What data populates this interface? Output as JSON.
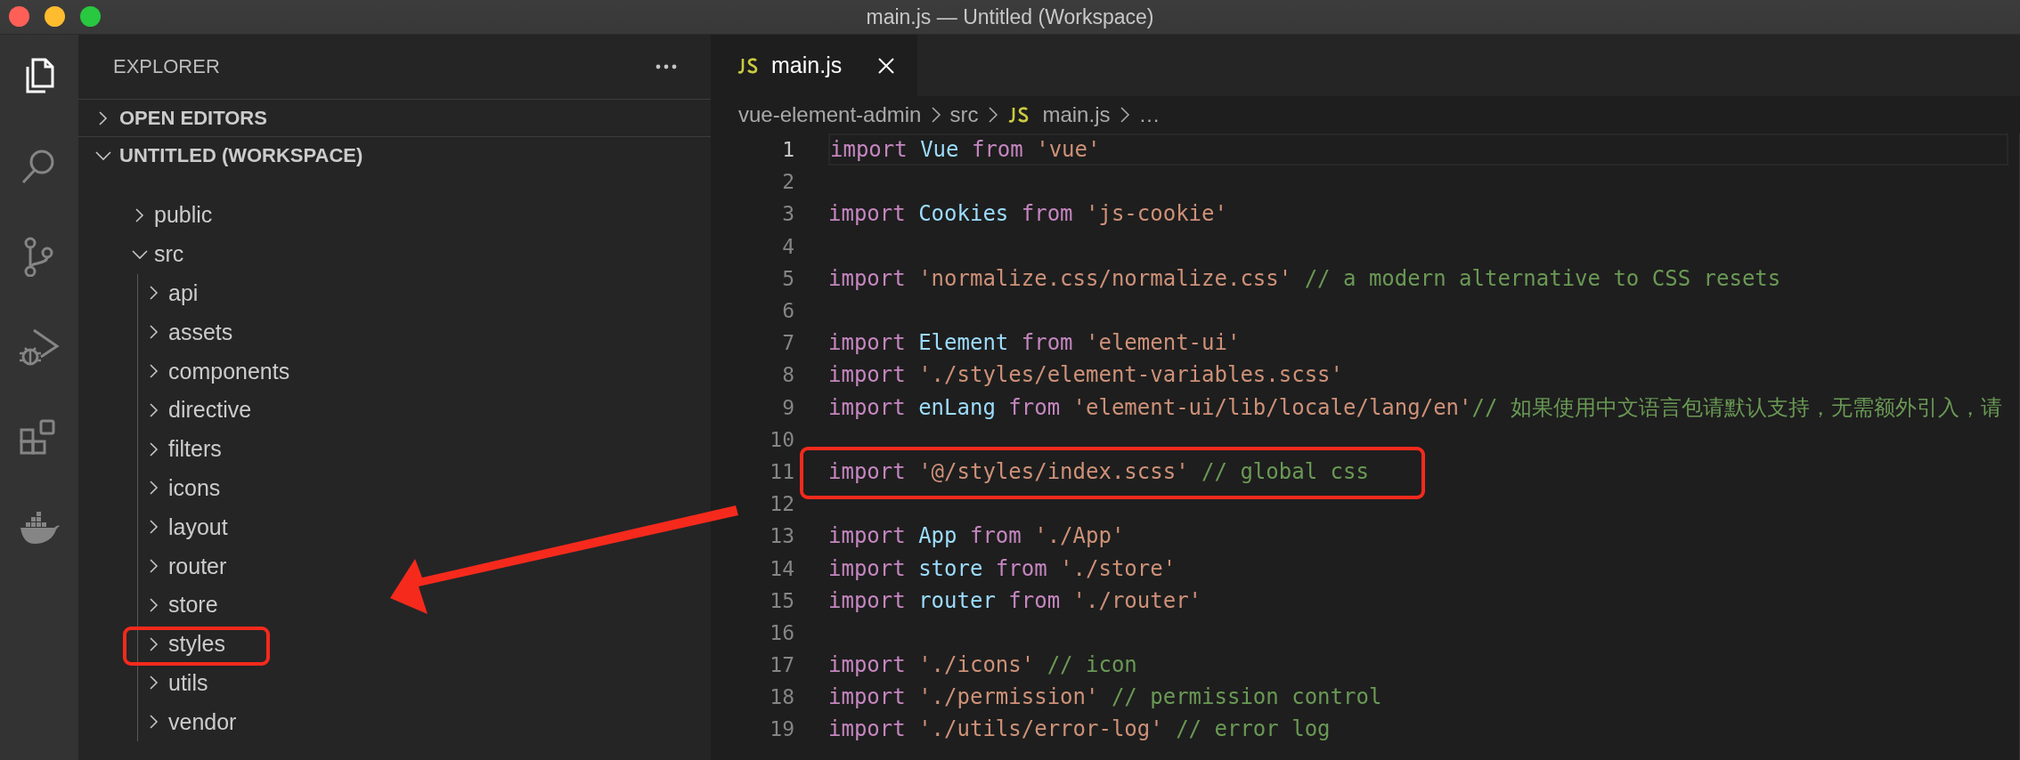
{
  "window": {
    "title": "main.js — Untitled (Workspace)"
  },
  "activity_bar": [
    {
      "kind": "explorer",
      "selected": true
    },
    {
      "kind": "search",
      "selected": false
    },
    {
      "kind": "source-control",
      "selected": false
    },
    {
      "kind": "run-debug",
      "selected": false
    },
    {
      "kind": "extensions",
      "selected": false
    },
    {
      "kind": "docker",
      "selected": false
    }
  ],
  "sidebar": {
    "title": "EXPLORER",
    "sections": [
      {
        "label": "OPEN EDITORS",
        "expanded": false
      },
      {
        "label": "UNTITLED (WORKSPACE)",
        "expanded": true,
        "children": [
          {
            "label": "public",
            "expanded": false
          },
          {
            "label": "src",
            "expanded": true,
            "children": [
              {
                "label": "api",
                "expanded": false
              },
              {
                "label": "assets",
                "expanded": false
              },
              {
                "label": "components",
                "expanded": false
              },
              {
                "label": "directive",
                "expanded": false
              },
              {
                "label": "filters",
                "expanded": false
              },
              {
                "label": "icons",
                "expanded": false
              },
              {
                "label": "layout",
                "expanded": false
              },
              {
                "label": "router",
                "expanded": false
              },
              {
                "label": "store",
                "expanded": false
              },
              {
                "label": "styles",
                "expanded": false
              },
              {
                "label": "utils",
                "expanded": false
              },
              {
                "label": "vendor",
                "expanded": false
              }
            ]
          }
        ]
      }
    ]
  },
  "tabs": [
    {
      "label": "main.js",
      "selected": true
    }
  ],
  "breadcrumbs": [
    {
      "kind": "folder",
      "label": "vue-element-admin"
    },
    {
      "kind": "folder",
      "label": "src"
    },
    {
      "kind": "file",
      "label": "main.js"
    },
    {
      "kind": "more",
      "label": "…"
    }
  ],
  "editor": {
    "lines": [
      {
        "number": "1",
        "current": true,
        "tokens": [
          {
            "kind": "keyword",
            "text": "import "
          },
          {
            "kind": "ident",
            "text": "Vue "
          },
          {
            "kind": "keyword",
            "text": "from "
          },
          {
            "kind": "string",
            "text": "'vue'"
          }
        ]
      },
      {
        "number": "2",
        "current": false
      },
      {
        "number": "3",
        "current": false,
        "tokens": [
          {
            "kind": "keyword",
            "text": "import "
          },
          {
            "kind": "ident",
            "text": "Cookies "
          },
          {
            "kind": "keyword",
            "text": "from "
          },
          {
            "kind": "string",
            "text": "'js-cookie'"
          }
        ]
      },
      {
        "number": "4",
        "current": false
      },
      {
        "number": "5",
        "current": false,
        "tokens": [
          {
            "kind": "keyword",
            "text": "import "
          },
          {
            "kind": "string",
            "text": "'normalize.css/normalize.css' "
          },
          {
            "kind": "comment",
            "text": "// a modern alternative to CSS resets"
          }
        ]
      },
      {
        "number": "6",
        "current": false
      },
      {
        "number": "7",
        "current": false,
        "tokens": [
          {
            "kind": "keyword",
            "text": "import "
          },
          {
            "kind": "ident",
            "text": "Element "
          },
          {
            "kind": "keyword",
            "text": "from "
          },
          {
            "kind": "string",
            "text": "'element-ui'"
          }
        ]
      },
      {
        "number": "8",
        "current": false,
        "tokens": [
          {
            "kind": "keyword",
            "text": "import "
          },
          {
            "kind": "string",
            "text": "'./styles/element-variables.scss'"
          }
        ]
      },
      {
        "number": "9",
        "current": false,
        "tokens": [
          {
            "kind": "keyword",
            "text": "import "
          },
          {
            "kind": "ident",
            "text": "enLang "
          },
          {
            "kind": "keyword",
            "text": "from "
          },
          {
            "kind": "string",
            "text": "'element-ui/lib/locale/lang/en'"
          },
          {
            "kind": "comment",
            "text": "// 如果使用中文语言包请默认支持，无需额外引入，请"
          }
        ]
      },
      {
        "number": "10",
        "current": false
      },
      {
        "number": "11",
        "current": false,
        "tokens": [
          {
            "kind": "keyword",
            "text": "import "
          },
          {
            "kind": "string",
            "text": "'@/styles/index.scss' "
          },
          {
            "kind": "comment",
            "text": "// global css"
          }
        ]
      },
      {
        "number": "12",
        "current": false
      },
      {
        "number": "13",
        "current": false,
        "tokens": [
          {
            "kind": "keyword",
            "text": "import "
          },
          {
            "kind": "ident",
            "text": "App "
          },
          {
            "kind": "keyword",
            "text": "from "
          },
          {
            "kind": "string",
            "text": "'./App'"
          }
        ]
      },
      {
        "number": "14",
        "current": false,
        "tokens": [
          {
            "kind": "keyword",
            "text": "import "
          },
          {
            "kind": "ident",
            "text": "store "
          },
          {
            "kind": "keyword",
            "text": "from "
          },
          {
            "kind": "string",
            "text": "'./store'"
          }
        ]
      },
      {
        "number": "15",
        "current": false,
        "tokens": [
          {
            "kind": "keyword",
            "text": "import "
          },
          {
            "kind": "ident",
            "text": "router "
          },
          {
            "kind": "keyword",
            "text": "from "
          },
          {
            "kind": "string",
            "text": "'./router'"
          }
        ]
      },
      {
        "number": "16",
        "current": false
      },
      {
        "number": "17",
        "current": false,
        "tokens": [
          {
            "kind": "keyword",
            "text": "import "
          },
          {
            "kind": "string",
            "text": "'./icons' "
          },
          {
            "kind": "comment",
            "text": "// icon"
          }
        ]
      },
      {
        "number": "18",
        "current": false,
        "tokens": [
          {
            "kind": "keyword",
            "text": "import "
          },
          {
            "kind": "string",
            "text": "'./permission' "
          },
          {
            "kind": "comment",
            "text": "// permission control"
          }
        ]
      },
      {
        "number": "19",
        "current": false,
        "tokens": [
          {
            "kind": "keyword",
            "text": "import "
          },
          {
            "kind": "string",
            "text": "'./utils/error-log' "
          },
          {
            "kind": "comment",
            "text": "// error log"
          }
        ]
      }
    ]
  }
}
